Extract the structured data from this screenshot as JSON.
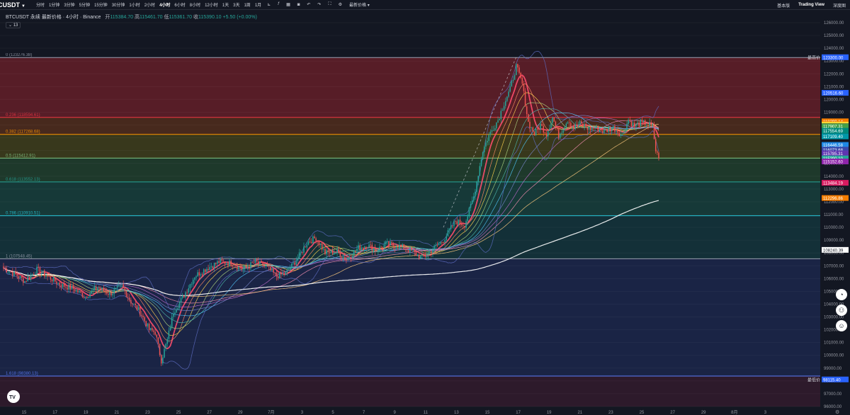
{
  "toolbar": {
    "symbol": "CUSDT",
    "timeframes": [
      "分时",
      "1分钟",
      "3分钟",
      "5分钟",
      "15分钟",
      "30分钟",
      "1小时",
      "2小时",
      "4小时",
      "6小时",
      "8小时",
      "12小时",
      "1天",
      "3天",
      "1周",
      "1月"
    ],
    "active_timeframe": "4小时",
    "tools": [
      "chart-type-icon",
      "indicator-icon",
      "template-icon",
      "camera-icon",
      "undo-icon",
      "redo-icon",
      "fullscreen-icon",
      "settings-icon"
    ],
    "price_mode": "最新价格",
    "right": [
      "基本版",
      "Trading View",
      "深度图"
    ],
    "right_active": "Trading View"
  },
  "legend": {
    "title": "BTCUSDT 永续 最新价格 · 4小时 · Binance",
    "open_label": "开",
    "open": "115384.70",
    "high_label": "高",
    "high": "115461.70",
    "low_label": "低",
    "low": "115361.70",
    "close_label": "收",
    "close": "115390.10",
    "change": "+5.50 (+0.00%)",
    "indicator_count": "13"
  },
  "chart_data": {
    "type": "candlestick",
    "symbol": "BTCUSDT",
    "interval": "4h",
    "y_range": [
      96000,
      126000
    ],
    "y_ticks": [
      96000,
      97000,
      98000,
      99000,
      100000,
      101000,
      102000,
      103000,
      104000,
      105000,
      106000,
      107000,
      108000,
      109000,
      110000,
      111000,
      112000,
      113000,
      114000,
      115000,
      116000,
      117000,
      118000,
      119000,
      120000,
      121000,
      122000,
      123000,
      124000,
      125000,
      126000
    ],
    "x_ticks": [
      "15",
      "17",
      "19",
      "21",
      "23",
      "25",
      "27",
      "29",
      "7月",
      "3",
      "5",
      "7",
      "9",
      "11",
      "13",
      "15",
      "17",
      "19",
      "21",
      "23",
      "25",
      "27",
      "29",
      "8月",
      "3"
    ],
    "fib_levels": [
      {
        "label": "0 (123276.38)",
        "ratio": 0,
        "price": 123276.38
      },
      {
        "label": "0.236 (118594.61)",
        "ratio": 0.236,
        "price": 118594.61
      },
      {
        "label": "0.382 (117268.68)",
        "ratio": 0.382,
        "price": 117268.68
      },
      {
        "label": "0.5 (115412.91)",
        "ratio": 0.5,
        "price": 115412.91
      },
      {
        "label": "0.618 (113552.13)",
        "ratio": 0.618,
        "price": 113552.13
      },
      {
        "label": "0.786 (110910.51)",
        "ratio": 0.786,
        "price": 110910.51
      },
      {
        "label": "1 (107548.45)",
        "ratio": 1,
        "price": 107548.45
      },
      {
        "label": "1.618 (98380.13)",
        "ratio": 1.618,
        "price": 98380.13
      }
    ],
    "zone_colors": [
      "#5b1e28",
      "#4a2a1e",
      "#3a3a1c",
      "#1f3b2c",
      "#163b3a",
      "#13323a",
      "#1a2548",
      "#2e1a2c"
    ],
    "level_colors": [
      "#9aa0b0",
      "#f23645",
      "#ff9800",
      "#81c784",
      "#26a69a",
      "#26c6da",
      "#9aa0b0",
      "#5c7cfa"
    ],
    "price_labels": [
      {
        "text": "123300.00",
        "price": 123300,
        "color": "#2962ff",
        "tag": "最高价"
      },
      {
        "text": "120516.60",
        "price": 120516.6,
        "color": "#2962ff"
      },
      {
        "text": "118290.14",
        "price": 118290.14,
        "color": "#f57c00"
      },
      {
        "text": "118065.10",
        "price": 118065.1,
        "color": "#ef6c00"
      },
      {
        "text": "118036.39",
        "price": 118036.39,
        "color": "#fdd835"
      },
      {
        "text": "117919.69",
        "price": 117919.69,
        "color": "#e53935"
      },
      {
        "text": "117907.31",
        "price": 117907.31,
        "color": "#43a047"
      },
      {
        "text": "117554.69",
        "price": 117554.69,
        "color": "#00897b"
      },
      {
        "text": "117109.40",
        "price": 117109.4,
        "color": "#0097a7"
      },
      {
        "text": "116446.58",
        "price": 116446.58,
        "color": "#1e88e5"
      },
      {
        "text": "116073.68",
        "price": 116073.68,
        "color": "#3949ab"
      },
      {
        "text": "115785.31",
        "price": 115785.31,
        "color": "#5e35b1"
      },
      {
        "text": "115390.10",
        "price": 115390.1,
        "color": "#26a69a"
      },
      {
        "text": "115152.60",
        "price": 115152.6,
        "color": "#8e24aa"
      },
      {
        "text": "113484.19",
        "price": 113484.19,
        "color": "#d81b60"
      },
      {
        "text": "112296.86",
        "price": 112296.86,
        "color": "#f57c00"
      },
      {
        "text": "108240.39",
        "price": 108240.39,
        "color": "#ffffff"
      },
      {
        "text": "98115.40",
        "price": 98115.4,
        "color": "#2962ff",
        "tag": "最低价"
      }
    ],
    "key_prices": {
      "ath_high": 123300,
      "low": 98115.4,
      "last": 115390.1
    },
    "candle_colors": {
      "up": "#26a69a",
      "down": "#ef5350"
    },
    "ma_colors": [
      "#ff4d6d",
      "#ff8a65",
      "#ffd54f",
      "#aed581",
      "#4db6ac",
      "#4fc3f7",
      "#7986cb",
      "#ba68c8",
      "#f48fb1",
      "#ffcc80",
      "#ffffff"
    ],
    "bollinger_color": "#5c6bc0"
  }
}
